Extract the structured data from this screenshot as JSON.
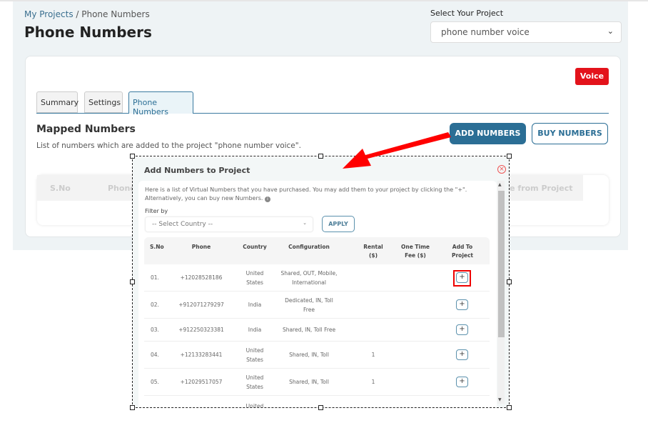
{
  "breadcrumb": {
    "parent": "My Projects",
    "separator": " / ",
    "current": "Phone Numbers"
  },
  "page_title": "Phone Numbers",
  "project_select": {
    "label": "Select Your Project",
    "value": "phone number voice"
  },
  "badge": "Voice",
  "tabs": [
    {
      "label": "Summary"
    },
    {
      "label": "Settings"
    },
    {
      "label": "Phone Numbers",
      "active": true
    }
  ],
  "mapped": {
    "title": "Mapped Numbers",
    "subtitle": "List of numbers which are added to the project \"phone number voice\"."
  },
  "buttons": {
    "add": "ADD NUMBERS",
    "buy": "BUY NUMBERS"
  },
  "bg_table": {
    "headers": [
      "S.No",
      "Phone",
      "Remove from Project"
    ]
  },
  "modal": {
    "title": "Add Numbers to Project",
    "description": "Here is a list of Virtual Numbers that you have purchased. You may add them to your project by clicking the \"+\". Alternatively, you can buy new Numbers.",
    "filter_label": "Filter by",
    "country_placeholder": "-- Select Country --",
    "apply": "APPLY",
    "headers": [
      "S.No",
      "Phone",
      "Country",
      "Configuration",
      "Rental ($)",
      "One Time Fee ($)",
      "Add To Project"
    ],
    "rows": [
      {
        "sno": "01.",
        "phone": "+12028528186",
        "country": "United States",
        "config": "Shared, OUT, Mobile, International",
        "rental": "",
        "fee": ""
      },
      {
        "sno": "02.",
        "phone": "+912071279297",
        "country": "India",
        "config": "Dedicated, IN, Toll Free",
        "rental": "",
        "fee": ""
      },
      {
        "sno": "03.",
        "phone": "+912250323381",
        "country": "India",
        "config": "Shared, IN, Toll Free",
        "rental": "",
        "fee": ""
      },
      {
        "sno": "04.",
        "phone": "+12133283441",
        "country": "United States",
        "config": "Shared, IN, Toll",
        "rental": "1",
        "fee": ""
      },
      {
        "sno": "05.",
        "phone": "+12029517057",
        "country": "United States",
        "config": "Shared, IN, Toll",
        "rental": "1",
        "fee": ""
      },
      {
        "sno": "",
        "phone": "",
        "country": "United",
        "config": "",
        "rental": "",
        "fee": ""
      }
    ]
  },
  "colors": {
    "primary": "#2b6e95",
    "voice": "#e3131b",
    "annotation": "#ff0000"
  },
  "icons": {
    "close": "circle-x-icon",
    "add": "plus-icon",
    "info": "info-icon",
    "dropdown": "chevron-down-icon"
  }
}
